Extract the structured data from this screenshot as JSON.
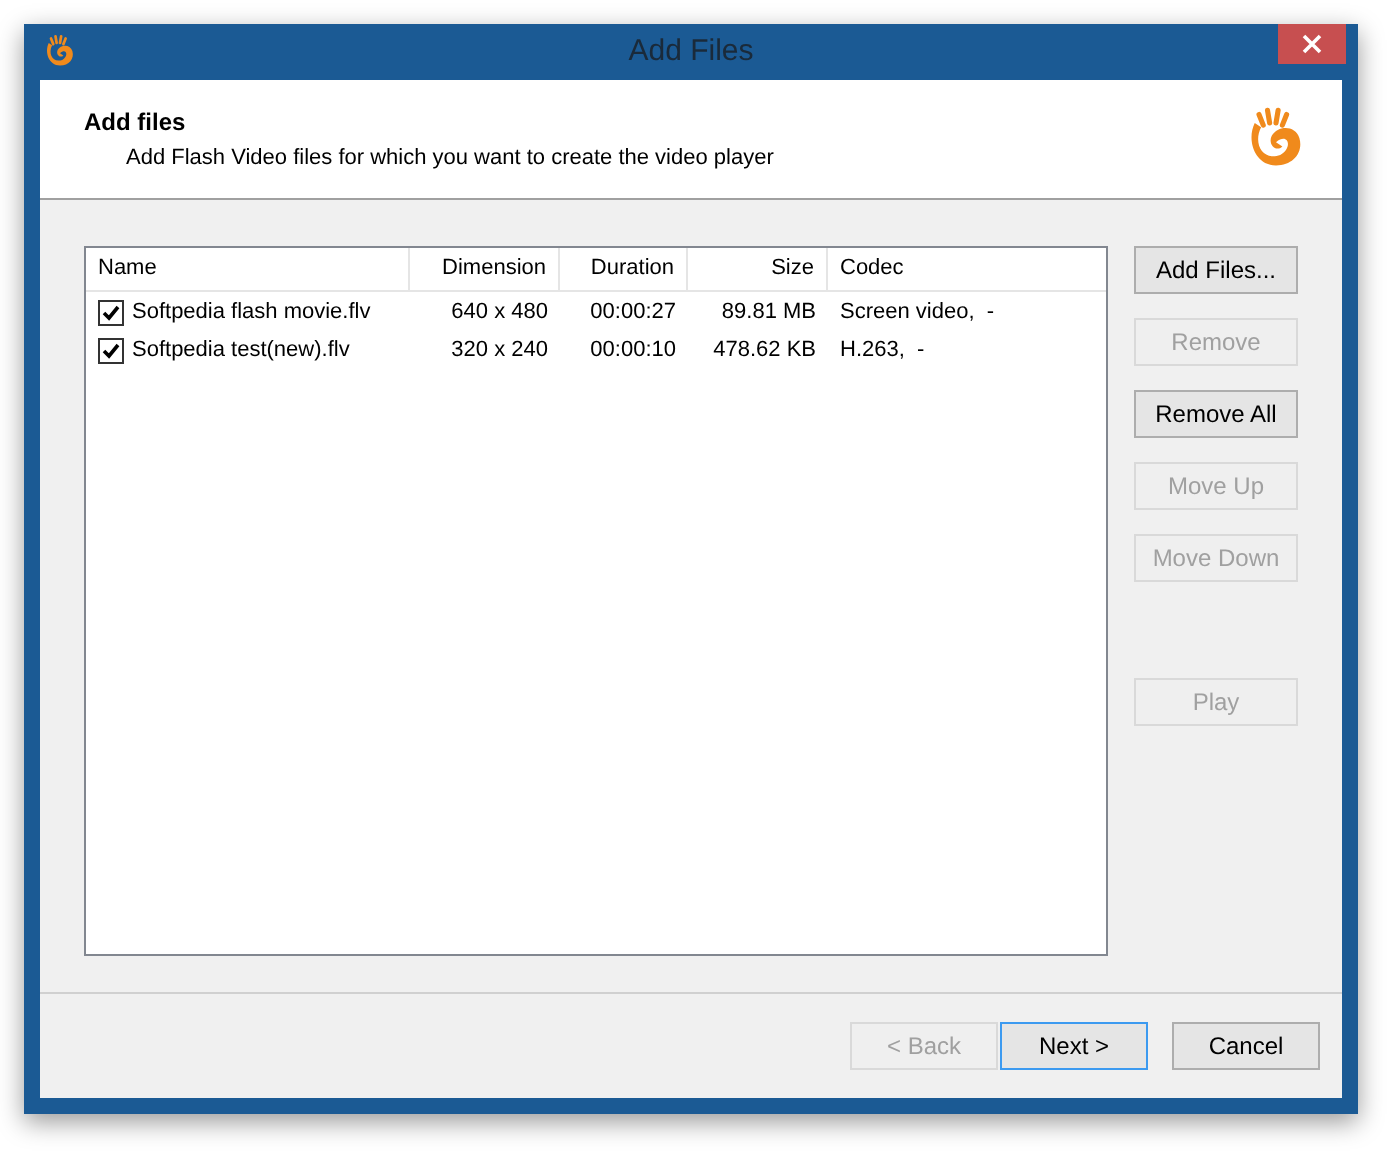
{
  "window": {
    "title": "Add Files"
  },
  "header": {
    "title": "Add files",
    "subtitle": "Add Flash Video files for which you want to create the video player"
  },
  "table": {
    "columns": [
      {
        "label": "Name"
      },
      {
        "label": "Dimension"
      },
      {
        "label": "Duration"
      },
      {
        "label": "Size"
      },
      {
        "label": "Codec"
      }
    ],
    "rows": [
      {
        "checked": true,
        "cells": [
          "Softpedia flash movie.flv",
          "640 x 480",
          "00:00:27",
          "89.81 MB",
          "Screen video,  -"
        ]
      },
      {
        "checked": true,
        "cells": [
          "Softpedia test(new).flv",
          "320 x 240",
          "00:00:10",
          "478.62 KB",
          "H.263,  -"
        ]
      }
    ]
  },
  "side_buttons": [
    {
      "label": "Add Files...",
      "disabled": false
    },
    {
      "label": "Remove",
      "disabled": true
    },
    {
      "label": "Remove All",
      "disabled": false
    },
    {
      "label": "Move Up",
      "disabled": true
    },
    {
      "label": "Move Down",
      "disabled": true
    },
    {
      "label": "Play",
      "disabled": true
    }
  ],
  "footer_buttons": [
    {
      "label": "< Back",
      "disabled": true,
      "default": false
    },
    {
      "label": "Next >",
      "disabled": false,
      "default": true
    },
    {
      "label": "Cancel",
      "disabled": false,
      "default": false
    }
  ]
}
